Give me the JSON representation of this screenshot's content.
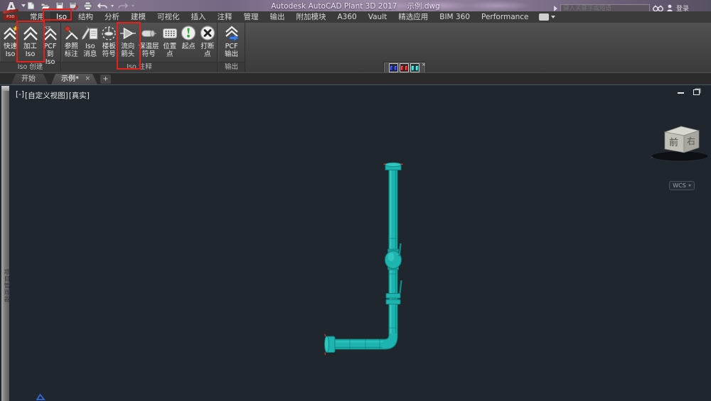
{
  "titlebar": {
    "logo_letter": "A",
    "logo_sub": "P3D",
    "app_title": "Autodesk AutoCAD Plant 3D 2017",
    "doc_title": "示例.dwg",
    "search_placeholder": "键入关键字或短语",
    "sign_in_label": "登录",
    "qat_icons": [
      "new-file",
      "open-file",
      "save",
      "save-as",
      "print",
      "undo",
      "redo"
    ]
  },
  "ribbon": {
    "tabs": [
      {
        "label": "常用"
      },
      {
        "label": "Iso",
        "highlighted": true
      },
      {
        "label": "结构"
      },
      {
        "label": "分析"
      },
      {
        "label": "建模"
      },
      {
        "label": "可视化"
      },
      {
        "label": "插入"
      },
      {
        "label": "注释"
      },
      {
        "label": "管理"
      },
      {
        "label": "输出"
      },
      {
        "label": "附加模块"
      },
      {
        "label": "A360"
      },
      {
        "label": "Vault"
      },
      {
        "label": "精选应用"
      },
      {
        "label": "BIM 360"
      },
      {
        "label": "Performance"
      }
    ],
    "panels": [
      {
        "title": "Iso 创建",
        "buttons": [
          {
            "label": "快速\nIso",
            "icon": "quick-iso"
          },
          {
            "label": "加工\nIso",
            "icon": "production-iso",
            "annotated": true
          },
          {
            "label": "PCF 到\nIso",
            "icon": "pcf-to-iso"
          }
        ]
      },
      {
        "title": "Iso 注释",
        "buttons": [
          {
            "label": "参照\n标注",
            "icon": "reference-annotation"
          },
          {
            "label": "Iso\n消息",
            "icon": "iso-message"
          },
          {
            "label": "楼板\n符号",
            "icon": "floor-symbol"
          },
          {
            "label": "流向\n箭头",
            "icon": "flow-arrow",
            "annotated": true
          },
          {
            "label": "保温层\n符号",
            "icon": "insulation-symbol"
          },
          {
            "label": "位置\n点",
            "icon": "location-point"
          },
          {
            "label": "起点",
            "icon": "start-point"
          },
          {
            "label": "打断\n点",
            "icon": "break-point"
          }
        ]
      },
      {
        "title": "输出",
        "buttons": [
          {
            "label": "PCF\n输出",
            "icon": "pcf-export"
          }
        ]
      }
    ]
  },
  "floating_toolbar": {
    "close_glyph": "×",
    "buttons": [
      {
        "name": "blue-tool",
        "color": "#2438d8"
      },
      {
        "name": "red-tool",
        "color": "#d41c1c"
      },
      {
        "name": "cyan-tool",
        "color": "#19cfd1"
      }
    ]
  },
  "file_tabs": {
    "tabs": [
      {
        "label": "开始"
      },
      {
        "label": "示例*",
        "active": true,
        "close_glyph": "×"
      }
    ],
    "new_tab_glyph": "+"
  },
  "project_manager": {
    "label": "项目管理器"
  },
  "viewport": {
    "controls": [
      "[-]",
      "[自定义视图]",
      "[真实]"
    ],
    "minimize_glyph": "–",
    "viewcube": {
      "front": "前",
      "right": "右"
    },
    "ucs_button": "WCS"
  },
  "annotations": {
    "color": "#e8201a",
    "boxes": [
      "iso-ribbon-tab",
      "production-iso-button",
      "flow-arrow-button"
    ]
  },
  "colors": {
    "pipe": "#1db4af",
    "pipe_dark": "#0d817e",
    "pipe_light": "#4fd8d2",
    "canvas": "#20262e",
    "titlebar_purple": "#84768f"
  }
}
